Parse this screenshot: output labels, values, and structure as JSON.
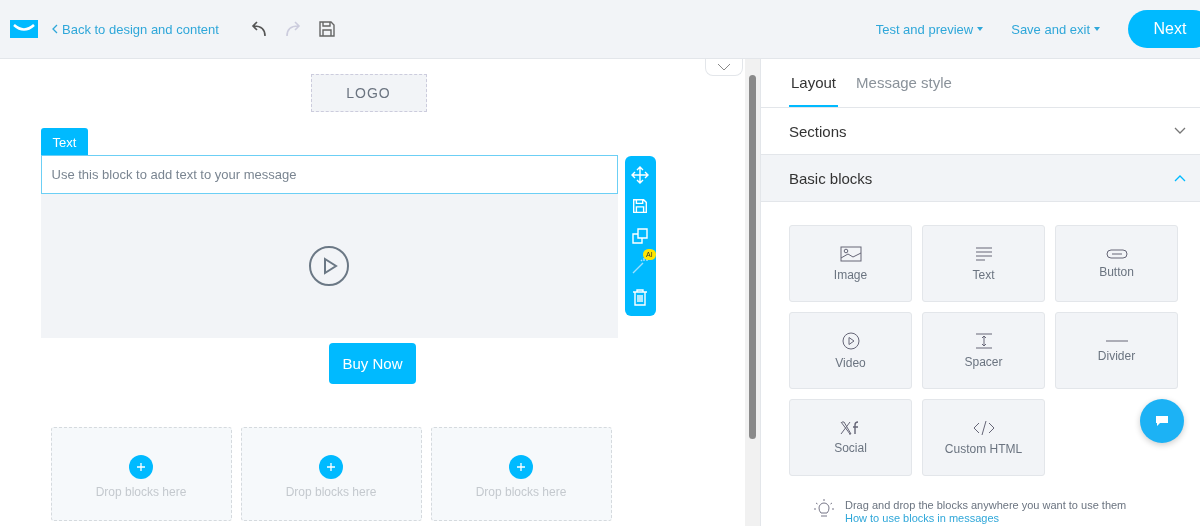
{
  "header": {
    "back_link": "Back to design and content",
    "test_preview": "Test and preview",
    "save_exit": "Save and exit",
    "next": "Next",
    "redo_disabled": true
  },
  "canvas": {
    "logo": "LOGO",
    "block_tab": "Text",
    "text_placeholder": "Use this block to add text to your message",
    "ai_badge": "AI",
    "cta": "Buy Now",
    "drop_zones": [
      {
        "label": "Drop blocks here"
      },
      {
        "label": "Drop blocks here"
      },
      {
        "label": "Drop blocks here"
      }
    ]
  },
  "panel": {
    "tabs": [
      {
        "label": "Layout",
        "selected": true
      },
      {
        "label": "Message style",
        "selected": false
      }
    ],
    "accordions": [
      {
        "label": "Sections",
        "expanded": false
      },
      {
        "label": "Basic blocks",
        "expanded": true
      }
    ],
    "blocks": [
      {
        "kind": "image",
        "label": "Image"
      },
      {
        "kind": "text",
        "label": "Text"
      },
      {
        "kind": "button",
        "label": "Button"
      },
      {
        "kind": "video",
        "label": "Video"
      },
      {
        "kind": "spacer",
        "label": "Spacer"
      },
      {
        "kind": "divider",
        "label": "Divider"
      },
      {
        "kind": "social",
        "label": "Social"
      },
      {
        "kind": "html",
        "label": "Custom HTML"
      }
    ],
    "tip": "Drag and drop the blocks anywhere you want to use them",
    "tip_link": "How to use blocks in messages"
  }
}
